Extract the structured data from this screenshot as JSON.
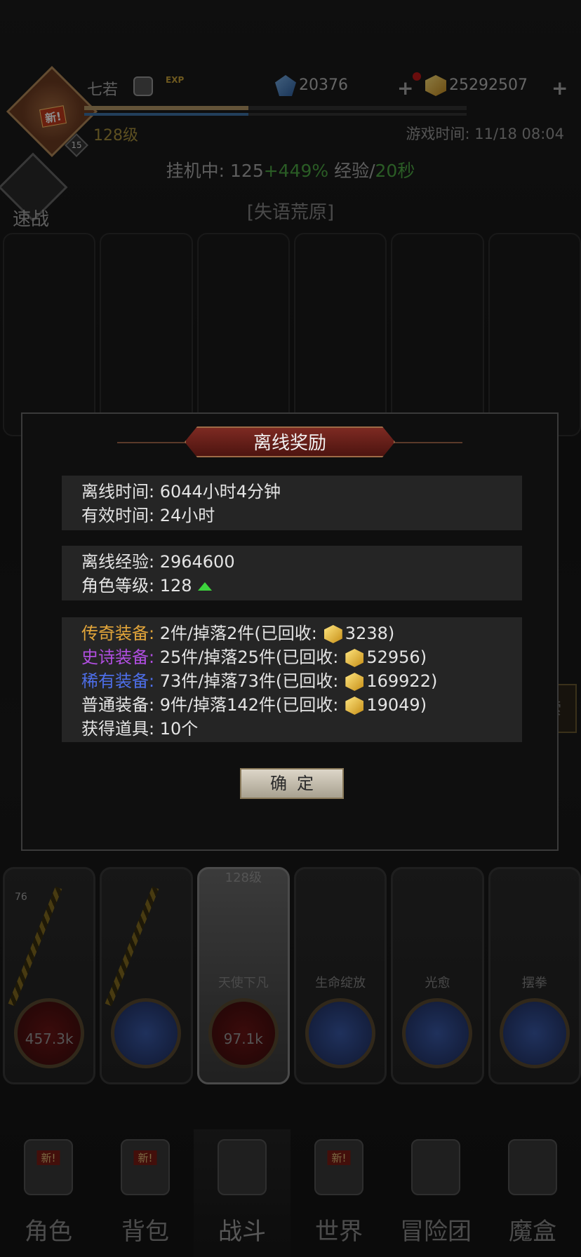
{
  "player": {
    "name": "七若",
    "level": "128级",
    "vip": "15",
    "avatar_badge": "新!",
    "exp_label": "EXP"
  },
  "resources": [
    {
      "icon": "blue-gem-icon",
      "value": "20376"
    },
    {
      "icon": "gold-gem-icon",
      "value": "25292507"
    }
  ],
  "game_time": "游戏时间: 11/18 08:04",
  "idle": {
    "prefix": "挂机中: 125",
    "bonus": "+449%",
    "exp_label": " 经验/",
    "interval": "20秒"
  },
  "quick_battle": "速战",
  "map_name": "[失语荒原]",
  "side_button": "世界探索",
  "dialog": {
    "title": "离线奖励",
    "panel1": {
      "offline_time": "离线时间: 6044小时4分钟",
      "effective_time": "有效时间: 24小时"
    },
    "panel2": {
      "offline_exp": "离线经验: 2964600",
      "role_level": "角色等级: 128"
    },
    "panel3": {
      "legendary_label": "传奇装备:",
      "legendary_text": " 2件/掉落2件(已回收:",
      "legendary_value": "3238)",
      "epic_label": "史诗装备:",
      "epic_text": " 25件/掉落25件(已回收:",
      "epic_value": "52956)",
      "rare_label": "稀有装备:",
      "rare_text": " 73件/掉落73件(已回收:",
      "rare_value": "169922)",
      "common_label": "普通装备:",
      "common_text": " 9件/掉落142件(已回收:",
      "common_value": "19049)",
      "items": "获得道具: 10个"
    },
    "confirm": "确定"
  },
  "cards": [
    {
      "name": "",
      "value": "457.3k",
      "level": "",
      "badge": "76"
    },
    {
      "name": "",
      "value": "",
      "level": "",
      "badge": ""
    },
    {
      "name": "天使下凡",
      "value": "97.1k",
      "level": "128级",
      "badge": ""
    },
    {
      "name": "生命绽放",
      "value": "",
      "level": "",
      "badge": ""
    },
    {
      "name": "光愈",
      "value": "",
      "level": "",
      "badge": ""
    },
    {
      "name": "摆拳",
      "value": "",
      "level": "",
      "badge": ""
    }
  ],
  "nav": [
    {
      "label": "角色",
      "icon": "helmet-icon",
      "new": "新!"
    },
    {
      "label": "背包",
      "icon": "backpack-icon",
      "new": "新!"
    },
    {
      "label": "战斗",
      "icon": "swords-icon",
      "new": ""
    },
    {
      "label": "世界",
      "icon": "scroll-icon",
      "new": "新!"
    },
    {
      "label": "冒险团",
      "icon": "castle-icon",
      "new": ""
    },
    {
      "label": "魔盒",
      "icon": "cube-icon",
      "new": ""
    }
  ]
}
